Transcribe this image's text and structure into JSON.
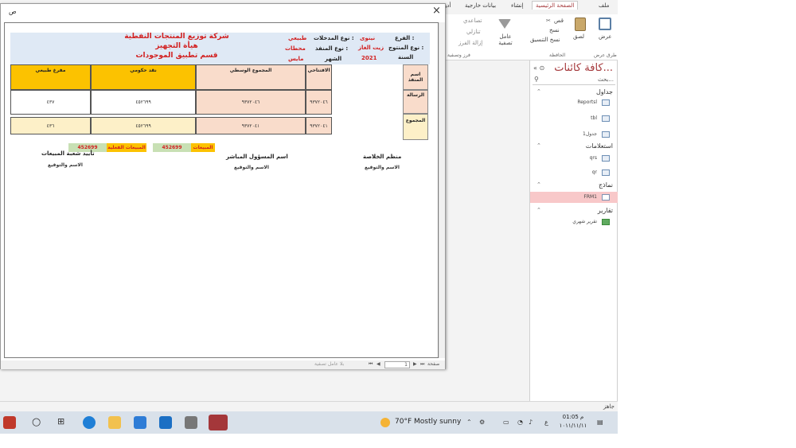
{
  "ribbon": {
    "tabs": [
      "ملف",
      "الصفحة الرئيسية",
      "إنشاء",
      "بيانات خارجية",
      "أدو"
    ],
    "view_label": "عرض",
    "paste_label": "لصق",
    "cut_label": "قص",
    "copy_label": "نسخ",
    "format_painter_label": "نسخ التنسيق",
    "filter_label": "عامل تصفية",
    "ascending_label": "تصاعدي",
    "descending_label": "تنازلي",
    "remove_sort_label": "إزالة الفرز",
    "group_views": "طرق عرض",
    "group_clipboard": "الحافظة",
    "group_sort": "فرز وتصفية"
  },
  "nav": {
    "title": "كافة كائنات...",
    "search_placeholder": "بحث...",
    "sections": [
      {
        "label": "جداول",
        "items": [
          "Reportsl",
          "tbl",
          "جدول1"
        ]
      },
      {
        "label": "استعلامات",
        "items": [
          "qrs",
          "qr"
        ]
      },
      {
        "label": "نماذج",
        "items": [
          "FRM1"
        ]
      },
      {
        "label": "تقارير",
        "items": [
          "تقرير شهري"
        ]
      }
    ]
  },
  "status": {
    "text": "جاهز"
  },
  "report_window": {
    "title": "ص",
    "close": "×",
    "page_value": "1",
    "page_label": "صفحة",
    "filter_label": "بلا عامل تصفية"
  },
  "report": {
    "company": "شركة توزيع المنتجات النفطية",
    "dept1": "هيأة التجهيز",
    "dept2": "قسم تطبيق الموجودات",
    "branch_label": "الفرع :",
    "branch_value": "نينوى",
    "product_label": "نوع المنتوج :",
    "product_value": "زيت الغاز",
    "year_label": "السنة",
    "year_value": "2021",
    "entry_label": "نوع المدخلات :",
    "entry_value": "طبيعي",
    "outlet_label": "نوع المنفذ :",
    "outlet_value": "محطات",
    "month_label": "الشهر",
    "month_value": "مايس",
    "side_header": "اسم المنفذ",
    "side_row1": "الرسالة",
    "side_total": "المجموع",
    "col_opening": "الافتتاحي",
    "col_mid": "المجموع الوسطي",
    "col_cash": "نقد حكومي",
    "col_normal": "مفرغ طبيعي",
    "row1": [
      "٩٣٧٢٠٤٦",
      "٩٣٧٢٠٤٦",
      "٤٥٢٦٩٩",
      "٤٣٧"
    ],
    "tot": [
      "٩٣٧٢٠٤١",
      "٩٣٧٢٠٤١",
      "٤٥٢٦٩٩",
      "٤٣٦"
    ],
    "sales_label": "المبيعات",
    "sales_value": "452699",
    "actual_label": "المبيعات الفعلية",
    "actual_value": "452699",
    "sig1_title": "منظم الخلاصة",
    "sig1_sub": "الاسم والتوقيع",
    "sig2_title": "اسم المسؤول المباشر",
    "sig2_sub": "الاسم والتوقيع",
    "sig3_title": "تأييد شعبة المبيعات",
    "sig3_sub": "الاسم والتوقيع"
  },
  "taskbar": {
    "weather": "70°F  Mostly sunny",
    "time": "01:05 م",
    "date": "١٠١١/١١/١١",
    "lang": "ع"
  }
}
